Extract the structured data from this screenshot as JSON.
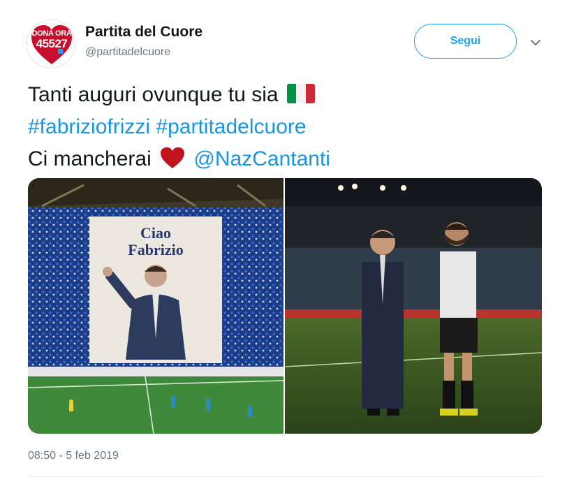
{
  "account": {
    "name": "Partita del Cuore",
    "handle": "@partitadelcuore",
    "avatar_line1": "DONA ORA",
    "avatar_line2": "45527"
  },
  "actions": {
    "follow_label": "Segui"
  },
  "tweet": {
    "line1": "Tanti auguri ovunque tu sia",
    "hashtag1": "#fabriziofrizzi",
    "hashtag2": "#partitadelcuore",
    "line3": "Ci mancherai",
    "mention": "@NazCantanti"
  },
  "media": {
    "banner_line1": "Ciao",
    "banner_line2": "Fabrizio"
  },
  "timestamp": "08:50 - 5 feb 2019",
  "colors": {
    "link": "#1b95e0",
    "follow_border": "#1da1f2",
    "brand_red": "#c8102e"
  }
}
